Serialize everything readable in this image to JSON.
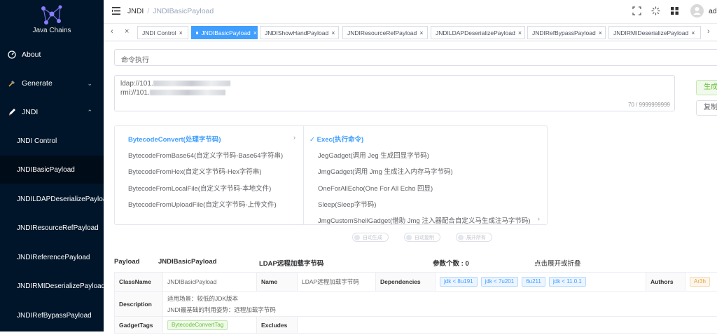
{
  "app": {
    "logo_text": "Java Chains"
  },
  "sidebar": {
    "menu": [
      {
        "label": "About",
        "icon": "dashboard-icon"
      },
      {
        "label": "Generate",
        "icon": "tools-icon",
        "arrow": "⌄"
      },
      {
        "label": "JNDI",
        "icon": "pen-icon",
        "arrow": "⌃"
      }
    ],
    "sub_items": [
      {
        "label": "JNDI Control"
      },
      {
        "label": "JNDIBasicPayload"
      },
      {
        "label": "JNDILDAPDeserializePayload"
      },
      {
        "label": "JNDIResourceRefPayload"
      },
      {
        "label": "JNDIReferencePayload"
      },
      {
        "label": "JNDIRMIDeserializePayload"
      },
      {
        "label": "JNDIRefBypassPayload"
      }
    ]
  },
  "navbar": {
    "breadcrumb": [
      "JNDI",
      "/",
      "JNDIBasicPayload"
    ],
    "user": "ad"
  },
  "tags": [
    {
      "label": "JNDI Control"
    },
    {
      "label": "JNDIBasicPayload"
    },
    {
      "label": "JNDIShowHandPayload"
    },
    {
      "label": "JNDIResourceRefPayload"
    },
    {
      "label": "JNDILDAPDeserializePayload"
    },
    {
      "label": "JNDIRefBypassPayload"
    },
    {
      "label": "JNDIRMIDeserializePayload"
    }
  ],
  "form": {
    "select_value": "命令执行",
    "output_lines": [
      "ldap://101.",
      "rmi://101."
    ],
    "counter": "70 / 9999999999",
    "generate_label": "生成",
    "copy_label": "复制"
  },
  "cascader": {
    "left": [
      "BytecodeConvert(处理字节码)",
      "BytecodeFromBase64(自定义字节码-Base64字符串)",
      "BytecodeFromHex(自定义字节码-Hex字符串)",
      "BytecodeFromLocalFile(自定义字节码-本地文件)",
      "BytecodeFromUploadFile(自定义字节码-上传文件)"
    ],
    "right": [
      "Exec(执行命令)",
      "JegGadget(调用 Jeg 生成回显字节码)",
      "JmgGadget(调用 Jmg 生成注入内存马字节码)",
      "OneForAllEcho(One For All Echo 回显)",
      "Sleep(Sleep字节码)",
      "JmgCustomShellGadget(借助 Jmg 注入器配合自定义马生成注马字节码)"
    ]
  },
  "switches": [
    "自动生成",
    "自动复制",
    "展开所有"
  ],
  "summary": {
    "payload_label": "Payload",
    "payload_name": "JNDIBasicPayload",
    "description": "LDAP远程加载字节码",
    "param_count": "参数个数 : 0",
    "toggle_hint": "点击展开或折叠"
  },
  "details": {
    "classname_label": "ClassName",
    "classname_value": "JNDIBasicPayload",
    "name_label": "Name",
    "name_value": "LDAP远程加载字节码",
    "dependencies_label": "Dependencies",
    "dependencies": [
      "jdk < 8u191",
      "jdk < 7u201",
      "6u211",
      "jdk < 11.0.1"
    ],
    "authors_label": "Authors",
    "authors": [
      "Ar3h"
    ],
    "description_label": "Description",
    "description_lines": [
      "适用场景：较低的JDK版本",
      "JNDI最基础的利用姿势：远程加载字节码"
    ],
    "gadgettags_label": "GadgetTags",
    "gadgettags": [
      "BytecodeConvertTag"
    ],
    "excludes_label": "Excludes"
  },
  "colors": {
    "sidebar_bg": "#001529",
    "primary": "#409eff",
    "success": "#67c23a"
  }
}
